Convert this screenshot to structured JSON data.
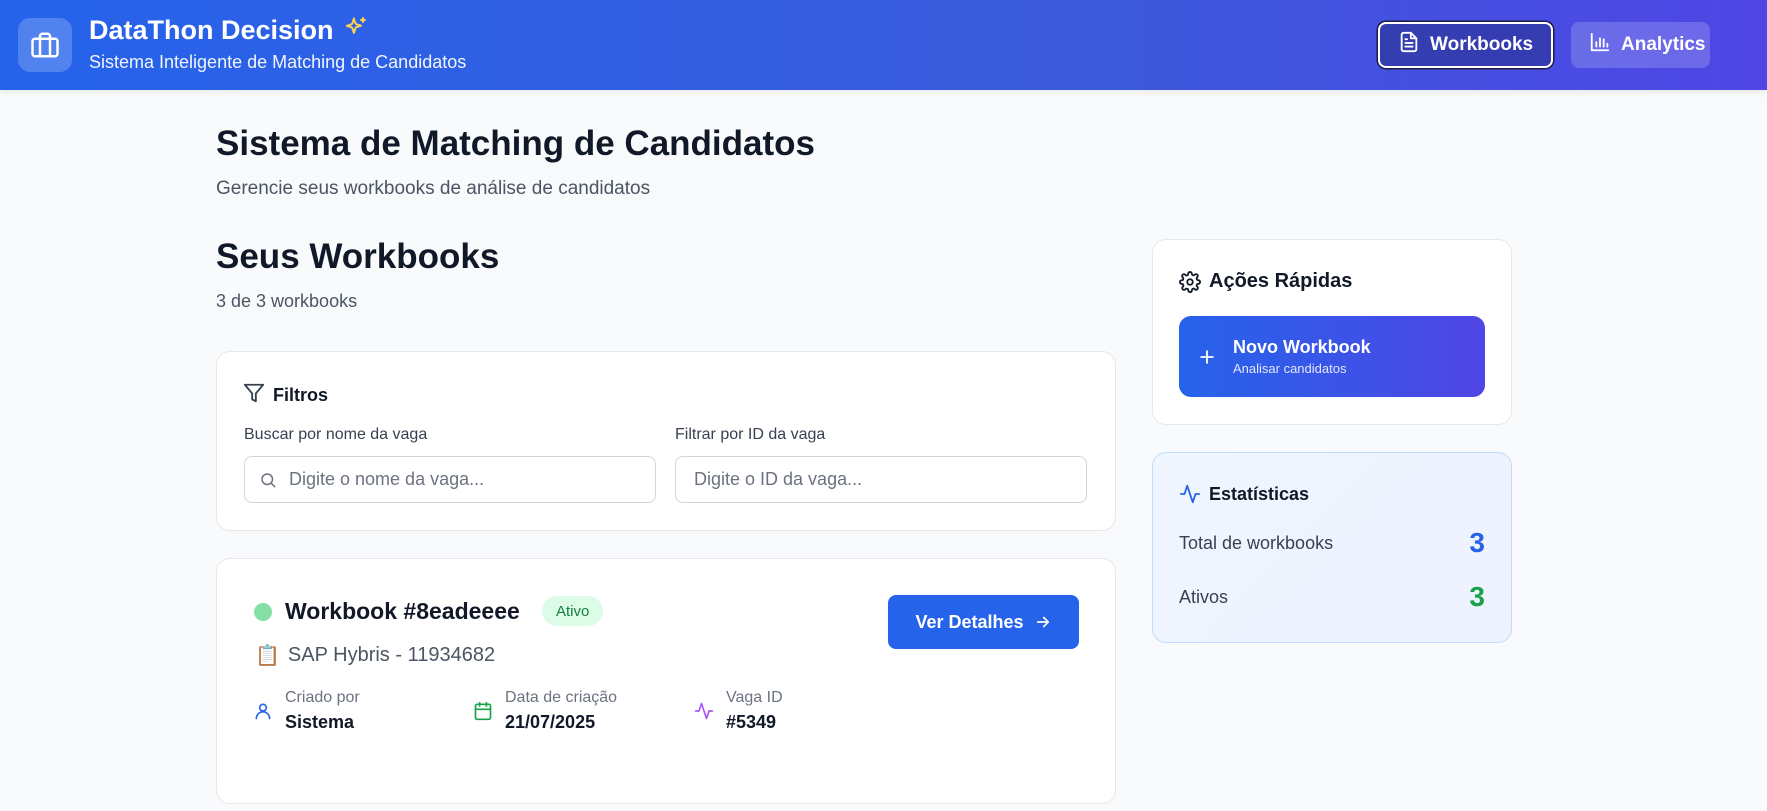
{
  "header": {
    "title": "DataThon Decision",
    "subtitle": "Sistema Inteligente de Matching de Candidatos",
    "nav": [
      {
        "label": "Workbooks",
        "icon": "document-icon",
        "active": true
      },
      {
        "label": "Analytics",
        "icon": "bar-chart-icon",
        "active": false
      }
    ]
  },
  "main": {
    "title": "Sistema de Matching de Candidatos",
    "subtitle": "Gerencie seus workbooks de análise de candidatos",
    "section_title": "Seus Workbooks",
    "section_count": "3 de 3 workbooks"
  },
  "filters": {
    "title": "Filtros",
    "search_label": "Buscar por nome da vaga",
    "search_placeholder": "Digite o nome da vaga...",
    "search_value": "",
    "id_label": "Filtrar por ID da vaga",
    "id_placeholder": "Digite o ID da vaga...",
    "id_value": ""
  },
  "workbooks": [
    {
      "title": "Workbook #8eadeeee",
      "status": "Ativo",
      "vaga": "SAP Hybris - 11934682",
      "vaga_emoji": "📋",
      "details_button": "Ver Detalhes",
      "created_by_label": "Criado por",
      "created_by": "Sistema",
      "date_label": "Data de criação",
      "date": "21/07/2025",
      "vaga_id_label": "Vaga ID",
      "vaga_id": "#5349"
    }
  ],
  "quick_actions": {
    "title": "Ações Rápidas",
    "new_title": "Novo Workbook",
    "new_subtitle": "Analisar candidatos"
  },
  "stats": {
    "title": "Estatísticas",
    "total_label": "Total de workbooks",
    "total_value": "3",
    "active_label": "Ativos",
    "active_value": "3"
  },
  "colors": {
    "primary": "#2563eb",
    "accent": "#4f46e5",
    "success": "#16a34a",
    "sparkle": "#fcd34d"
  }
}
